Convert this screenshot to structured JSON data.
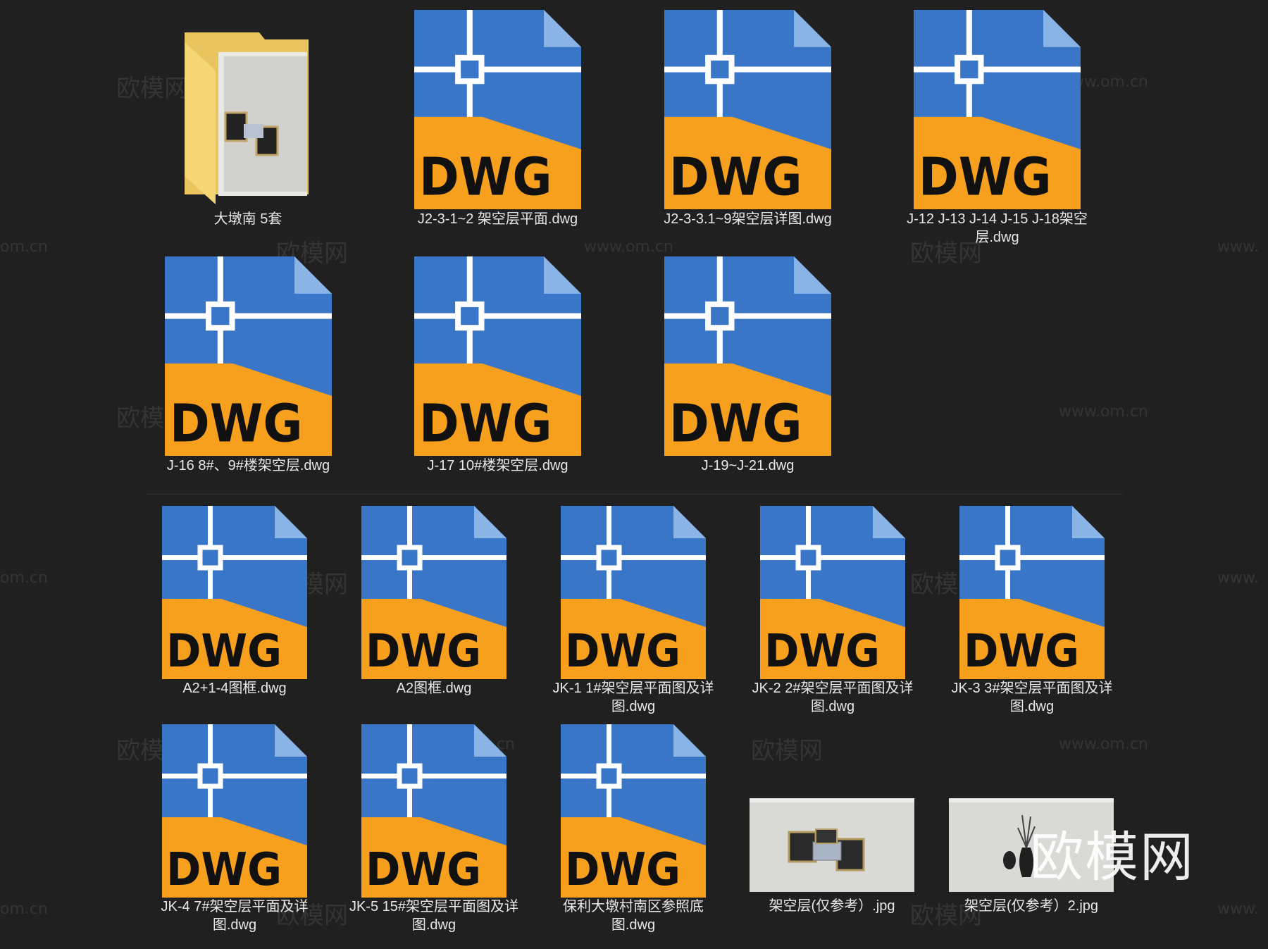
{
  "files": [
    {
      "name": "大墩南 5套",
      "type": "folder"
    },
    {
      "name": "J2-3-1~2 架空层平面.dwg",
      "type": "dwg"
    },
    {
      "name": "J2-3-3.1~9架空层详图.dwg",
      "type": "dwg"
    },
    {
      "name": "J-12 J-13 J-14 J-15 J-18架空层.dwg",
      "type": "dwg"
    },
    {
      "name": "J-16 8#、9#楼架空层.dwg",
      "type": "dwg"
    },
    {
      "name": "J-17 10#楼架空层.dwg",
      "type": "dwg"
    },
    {
      "name": "J-19~J-21.dwg",
      "type": "dwg"
    },
    {
      "name": "A2+1-4图框.dwg",
      "type": "dwg"
    },
    {
      "name": "A2图框.dwg",
      "type": "dwg"
    },
    {
      "name": "JK-1 1#架空层平面图及详图.dwg",
      "type": "dwg"
    },
    {
      "name": "JK-2 2#架空层平面图及详图.dwg",
      "type": "dwg"
    },
    {
      "name": "JK-3 3#架空层平面图及详图.dwg",
      "type": "dwg"
    },
    {
      "name": "JK-4 7#架空层平面及详图.dwg",
      "type": "dwg"
    },
    {
      "name": "JK-5 15#架空层平面图及详图.dwg",
      "type": "dwg"
    },
    {
      "name": "保利大墩村南区参照底图.dwg",
      "type": "dwg"
    },
    {
      "name": "架空层(仅参考）.jpg",
      "type": "jpg"
    },
    {
      "name": "架空层(仅参考）2.jpg",
      "type": "jpg"
    }
  ],
  "dwg_icon": {
    "badge_text": "DWG",
    "blue": "#3a76c8",
    "orange": "#f7a01d",
    "fold": "#8ab3e6",
    "line": "#ffffff"
  },
  "folder_icon": {
    "back": "#e9c45f",
    "front": "#f5d776"
  },
  "watermarks": {
    "cn": "欧模网",
    "url": "www.om.cn",
    "url_partial": "om.cn",
    "url_lead": "www."
  },
  "brand_watermark": "欧模网"
}
